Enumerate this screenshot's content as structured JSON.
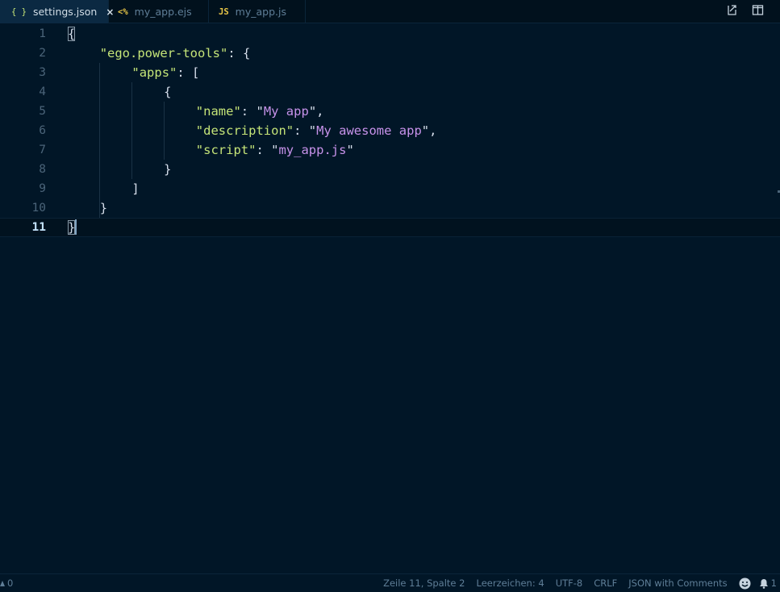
{
  "tabs": [
    {
      "icon": "{ }",
      "icon_name": "json-braces-icon",
      "label": "settings.json",
      "active": true,
      "close": "×"
    },
    {
      "icon": "<%",
      "icon_name": "ejs-file-icon",
      "label": "my_app.ejs",
      "active": false
    },
    {
      "icon": "JS",
      "icon_name": "javascript-file-icon",
      "label": "my_app.js",
      "active": false
    }
  ],
  "editor": {
    "language": "JSON with Comments",
    "active_line": 11,
    "line_numbers": [
      "1",
      "2",
      "3",
      "4",
      "5",
      "6",
      "7",
      "8",
      "9",
      "10",
      "11"
    ],
    "lines": [
      {
        "tokens": [
          {
            "t": "{",
            "c": "p"
          }
        ]
      },
      {
        "tokens": [
          {
            "t": "\"ego.power-tools\"",
            "c": "k"
          },
          {
            "t": ": {",
            "c": "p"
          }
        ]
      },
      {
        "tokens": [
          {
            "t": "\"apps\"",
            "c": "k"
          },
          {
            "t": ": [",
            "c": "p"
          }
        ]
      },
      {
        "tokens": [
          {
            "t": "{",
            "c": "p"
          }
        ]
      },
      {
        "tokens": [
          {
            "t": "\"name\"",
            "c": "k"
          },
          {
            "t": ": ",
            "c": "p"
          },
          {
            "t": "\"",
            "c": "p"
          },
          {
            "t": "My app",
            "c": "s"
          },
          {
            "t": "\",",
            "c": "p"
          }
        ]
      },
      {
        "tokens": [
          {
            "t": "\"description\"",
            "c": "k"
          },
          {
            "t": ": ",
            "c": "p"
          },
          {
            "t": "\"",
            "c": "p"
          },
          {
            "t": "My awesome app",
            "c": "s"
          },
          {
            "t": "\",",
            "c": "p"
          }
        ]
      },
      {
        "tokens": [
          {
            "t": "\"script\"",
            "c": "k"
          },
          {
            "t": ": ",
            "c": "p"
          },
          {
            "t": "\"",
            "c": "p"
          },
          {
            "t": "my_app.js",
            "c": "s"
          },
          {
            "t": "\"",
            "c": "p"
          }
        ]
      },
      {
        "tokens": [
          {
            "t": "}",
            "c": "p"
          }
        ]
      },
      {
        "tokens": [
          {
            "t": "]",
            "c": "p"
          }
        ]
      },
      {
        "tokens": [
          {
            "t": "}",
            "c": "p"
          }
        ]
      },
      {
        "tokens": [
          {
            "t": "}",
            "c": "p"
          }
        ]
      }
    ],
    "indent_levels": [
      0,
      1,
      2,
      3,
      4,
      4,
      4,
      3,
      2,
      1,
      0
    ]
  },
  "statusbar": {
    "problems": "0",
    "position": "Zeile 11, Spalte 2",
    "indent": "Leerzeichen: 4",
    "encoding": "UTF-8",
    "eol": "CRLF",
    "language": "JSON with Comments",
    "notifications": "1"
  },
  "colors": {
    "background": "#011627",
    "key": "#c5e478",
    "string": "#c792ea",
    "punctuation": "#d6deeb",
    "line_number": "#4b6479"
  }
}
